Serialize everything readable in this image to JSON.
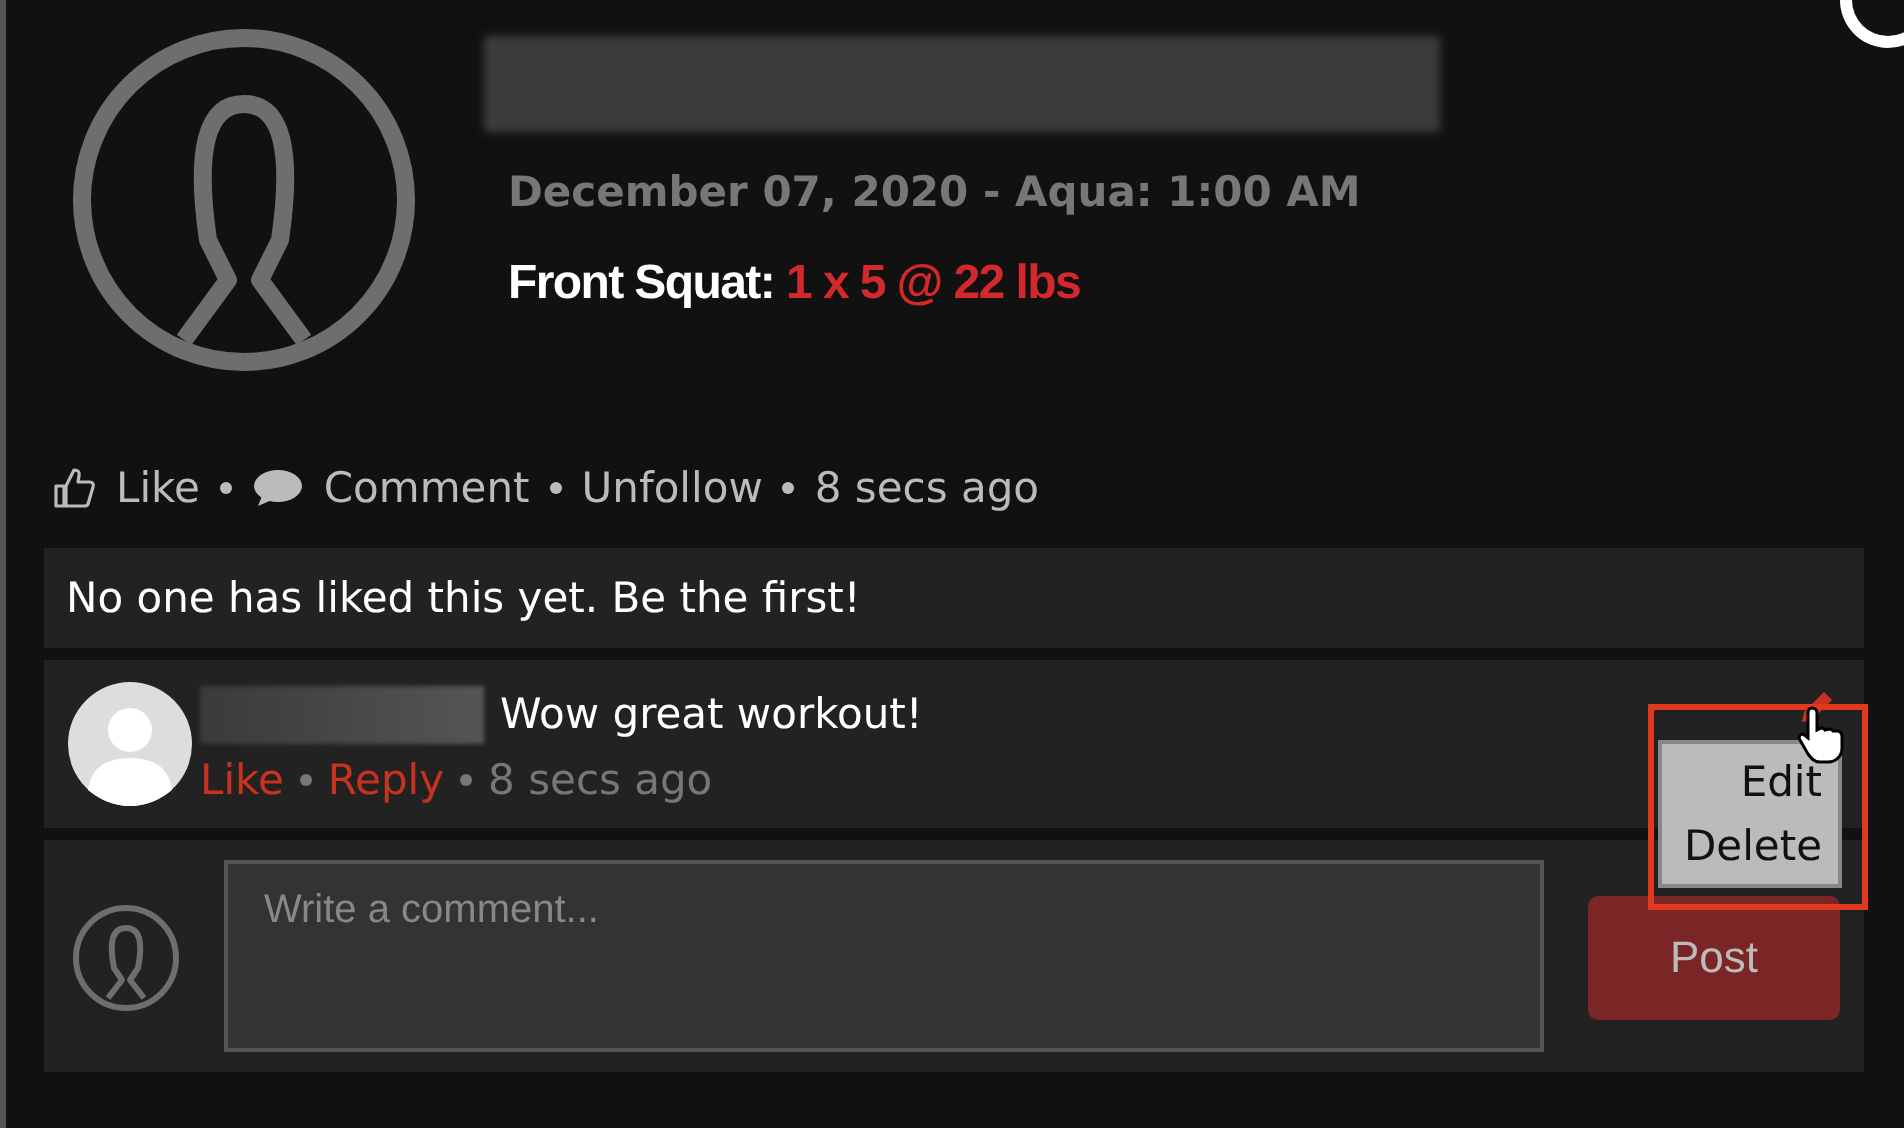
{
  "post": {
    "date": "December 07, 2020 - Aqua: 1:00 AM",
    "exercise": "Front Squat:",
    "result": "1 x 5 @ 22 lbs"
  },
  "actions": [
    {
      "kind": "like",
      "label": "Like"
    },
    {
      "kind": "comment",
      "label": "Comment"
    },
    {
      "kind": "link",
      "label": "Unfollow"
    }
  ],
  "time": "8 secs ago",
  "likes_note": "No one has liked this yet. Be the first!",
  "comments": [
    {
      "text": "Wow great workout!",
      "actions": [
        "Like",
        "Reply"
      ],
      "time": "8 secs ago",
      "menu": {
        "open": true,
        "items": [
          "Edit",
          "Delete"
        ]
      }
    }
  ],
  "composer": {
    "placeholder": "Write a comment...",
    "button": "Post"
  }
}
